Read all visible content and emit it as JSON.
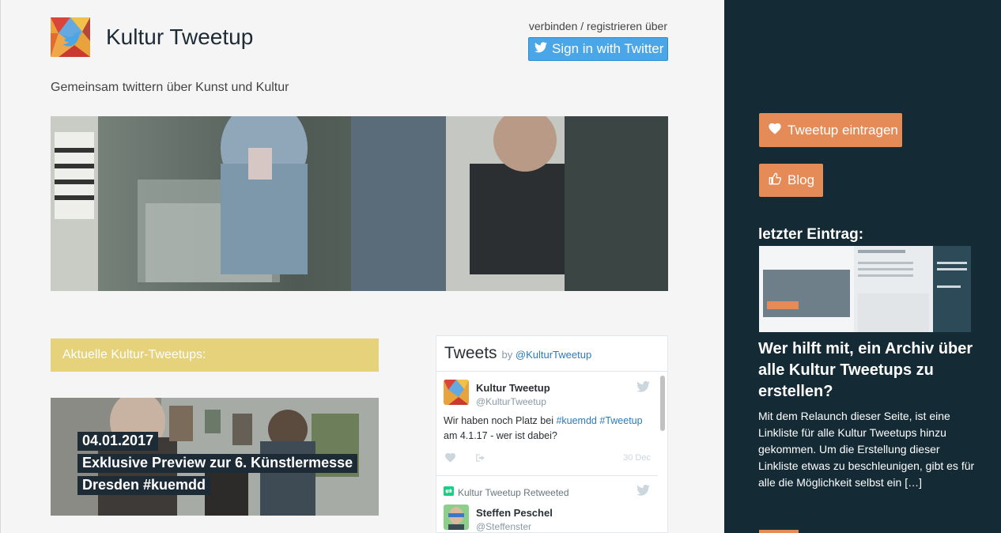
{
  "header": {
    "site_title": "Kultur Tweetup",
    "connect_label": "verbinden / registrieren über",
    "twitter_button": "Sign in with Twitter",
    "tagline": "Gemeinsam twittern über Kunst und Kultur"
  },
  "section": {
    "heading": "Aktuelle Kultur-Tweetups:"
  },
  "event": {
    "date": "04.01.2017",
    "title_line1": "Exklusive Preview zur 6. Künstlermesse",
    "title_line2": "Dresden #kuemdd"
  },
  "tweets_widget": {
    "title": "Tweets",
    "by": "by",
    "account": "@KulturTweetup",
    "tweet1": {
      "name": "Kultur Tweetup",
      "handle": "@KulturTweetup",
      "text_prefix": "Wir haben noch Platz bei ",
      "tag1": "#kuemdd",
      "tag2": "#Tweetup",
      "text_suffix": "am 4.1.17 - wer ist dabei?",
      "date": "30 Dec"
    },
    "tweet2": {
      "retweet_label": "Kultur Tweetup Retweeted",
      "name": "Steffen Peschel",
      "handle": "@Steffenster"
    }
  },
  "sidebar": {
    "tweetup_button": "Tweetup eintragen",
    "blog_button": "Blog",
    "last_entry_label": "letzter Eintrag:",
    "entry_title": "Wer hilft mit, ein Archiv über alle Kultur Tweetups zu erstellen?",
    "entry_excerpt": "Mit dem Relaunch dieser Seite, ist eine Linkliste für alle Kultur Tweetups hinzu gekommen. Um die Erstellung dieser Linkliste etwas zu beschleunigen, gibt es für alle die Möglichkeit selbst ein […]"
  },
  "colors": {
    "sidebar_bg": "#142b36",
    "accent_orange": "#e58b58",
    "twitter_blue": "#4aa6e6",
    "section_yellow": "#e5d27a"
  }
}
